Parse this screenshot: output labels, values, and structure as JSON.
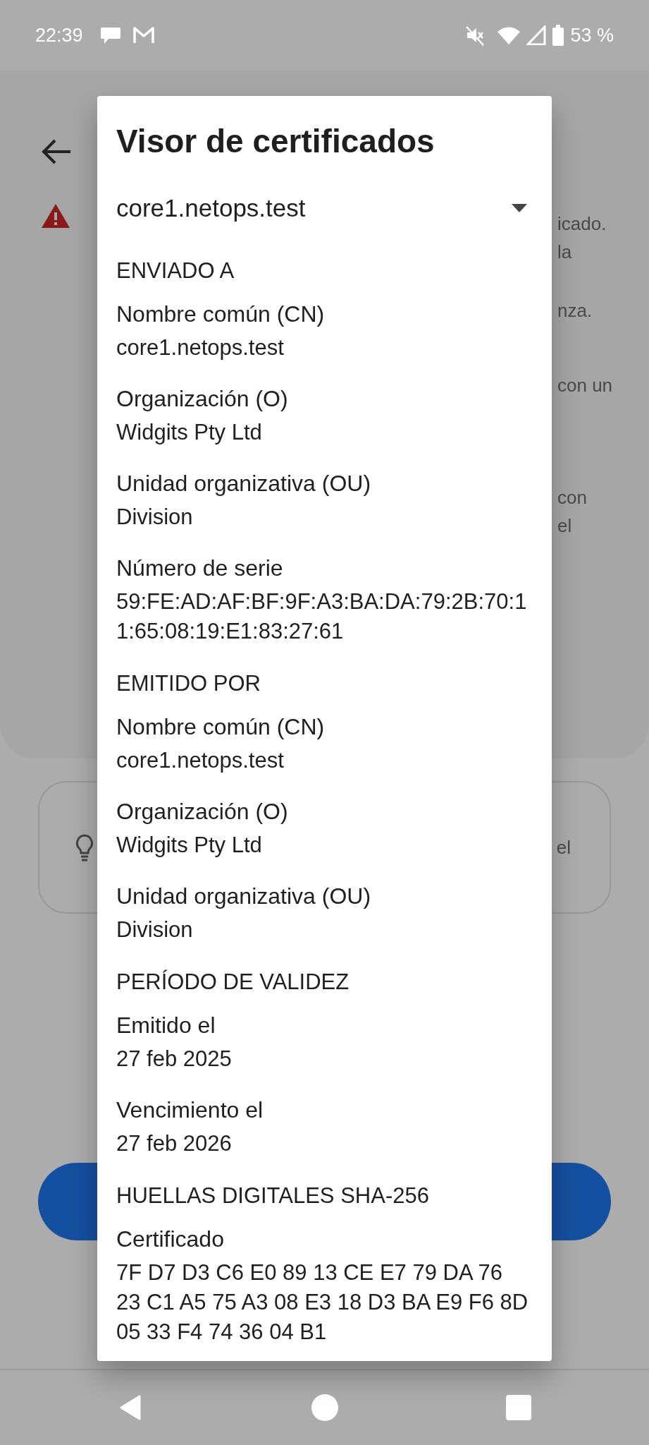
{
  "status_bar": {
    "time": "22:39",
    "battery": "53 %"
  },
  "background": {
    "paragraphs": [
      [
        "icado.",
        "la"
      ],
      [
        "nza."
      ],
      [
        "con un"
      ],
      [
        "con",
        "el"
      ]
    ],
    "tip_fragment": "el"
  },
  "dialog": {
    "title": "Visor de certificados",
    "selector": {
      "value": "core1.netops.test"
    },
    "sections": [
      {
        "heading": "ENVIADO A",
        "fields": [
          {
            "label": "Nombre común (CN)",
            "value": "core1.netops.test"
          },
          {
            "label": "Organización (O)",
            "value": "Widgits Pty Ltd"
          },
          {
            "label": "Unidad organizativa (OU)",
            "value": "Division"
          },
          {
            "label": "Número de serie",
            "value": "59:FE:AD:AF:BF:9F:A3:BA:DA:79:2B:70:11:65:08:19:E1:83:27:61"
          }
        ]
      },
      {
        "heading": "EMITIDO POR",
        "fields": [
          {
            "label": "Nombre común (CN)",
            "value": "core1.netops.test"
          },
          {
            "label": "Organización (O)",
            "value": "Widgits Pty Ltd"
          },
          {
            "label": "Unidad organizativa (OU)",
            "value": "Division"
          }
        ]
      },
      {
        "heading": "PERÍODO DE VALIDEZ",
        "fields": [
          {
            "label": "Emitido el",
            "value": "27 feb 2025"
          },
          {
            "label": "Vencimiento el",
            "value": "27 feb 2026"
          }
        ]
      },
      {
        "heading": "HUELLAS DIGITALES SHA-256",
        "fields": [
          {
            "label": "Certificado",
            "value": "7F D7 D3 C6 E0 89 13 CE E7 79 DA 76 23 C1 A5 75 A3 08 E3 18 D3 BA E9 F6 8D 05 33 F4 74 36 04 B1"
          }
        ]
      }
    ]
  }
}
